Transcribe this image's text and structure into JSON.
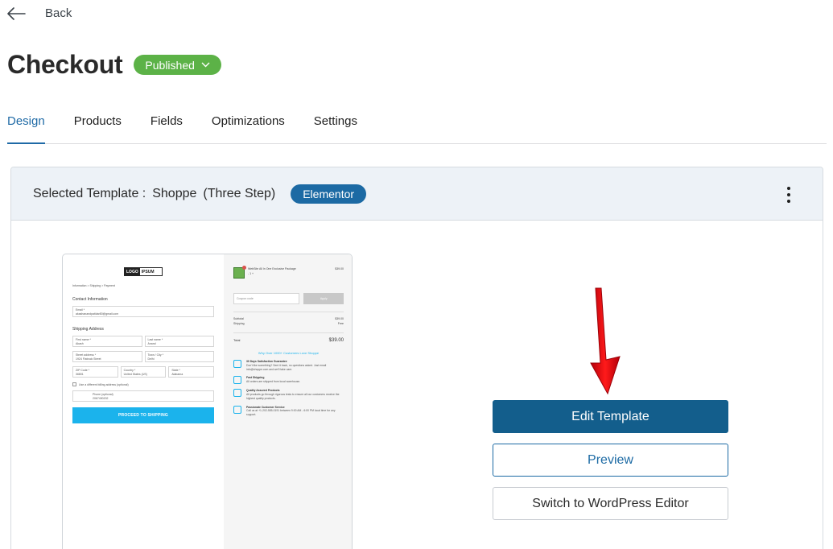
{
  "nav": {
    "back_label": "Back"
  },
  "header": {
    "title": "Checkout",
    "status": "Published"
  },
  "tabs": [
    {
      "label": "Design",
      "active": true
    },
    {
      "label": "Products",
      "active": false
    },
    {
      "label": "Fields",
      "active": false
    },
    {
      "label": "Optimizations",
      "active": false
    },
    {
      "label": "Settings",
      "active": false
    }
  ],
  "template": {
    "selected_label": "Selected Template :",
    "name": "Shoppe",
    "variant": "(Three Step)",
    "builder": "Elementor"
  },
  "preview": {
    "logo_a": "LOGO",
    "logo_b": "IPSUM",
    "breadcrumb": "Information  >  Shipping  >  Payment",
    "contact_heading": "Contact Information",
    "email_label": "Email *",
    "email_value": "akashanandpatidar80@gmail.com",
    "shipping_heading": "Shipping Address",
    "first_name_label": "First name *",
    "first_name": "Akash",
    "last_name_label": "Last name *",
    "last_name": "Anand",
    "street_label": "Street address *",
    "street": "1924 Flatrock Street",
    "city_label": "Town / City *",
    "city": "Delhi",
    "zip_label": "ZIP Code *",
    "zip": "36801",
    "country_label": "Country *",
    "country": "United States (US)",
    "state_label": "State *",
    "state": "Alabama",
    "billing_check": "Use a different billing address (optional)",
    "phone_label": "Phone (optional)",
    "phone": "2067490202",
    "proceed_button": "PROCEED TO SHIPPING",
    "product_name": "WebSite All In One Exclusive Package",
    "product_qty": "-  1  +",
    "product_price": "$39.00",
    "coupon_placeholder": "Coupon code",
    "apply_label": "Apply",
    "subtotal_label": "Subtotal",
    "subtotal_value": "$39.00",
    "shipping_label": "Shipping",
    "shipping_value": "Free",
    "total_label": "Total",
    "total_value": "$39.00",
    "why_heading": "Why Over 1000+ Customers Love Shoppe",
    "features": [
      {
        "title": "30 Days Satisfaction Guarantee",
        "text": "Don't like something? Sent it back, no questions asked. Just email info@shoppe.com and we'll take care."
      },
      {
        "title": "Fast Shipping",
        "text": "All orders are shipped from local warehouse."
      },
      {
        "title": "Quality Assured Products",
        "text": "All products go through rigorous tests to ensure all our customers receive the highest quality products."
      },
      {
        "title": "Passionate Customer Service",
        "text": "Call us at +1-202-555-0191 between 9:00 AM - 6:00 PM local time for any support."
      }
    ]
  },
  "actions": {
    "edit": "Edit Template",
    "preview": "Preview",
    "switch": "Switch to WordPress Editor"
  },
  "colors": {
    "published": "#5cb247",
    "elementor": "#1c6aa4",
    "primary_button": "#135e8c",
    "active_tab": "#1f6aa6",
    "annotation_arrow": "#e8000b"
  }
}
